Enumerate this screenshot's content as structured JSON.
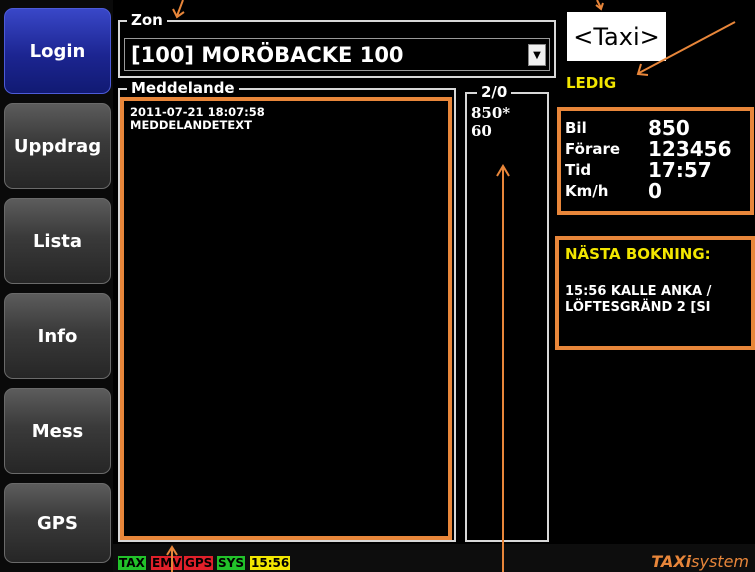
{
  "sidebar": {
    "items": [
      {
        "label": "Login"
      },
      {
        "label": "Uppdrag"
      },
      {
        "label": "Lista"
      },
      {
        "label": "Info"
      },
      {
        "label": "Mess"
      },
      {
        "label": "GPS"
      }
    ]
  },
  "zone": {
    "legend": "Zon",
    "selected": "[100] MORÖBACKE 100"
  },
  "messages": {
    "legend": "Meddelande",
    "timestamp": "2011-07-21 18:07:58",
    "text": "MEDDELANDETEXT"
  },
  "side_panel": {
    "legend": "2/0",
    "items": [
      "850*",
      "60"
    ]
  },
  "taxi_badge": "<Taxi>",
  "status": "LEDIG",
  "vehicle_info": {
    "bil_label": "Bil",
    "bil_value": "850",
    "forare_label": "Förare",
    "forare_value": "123456",
    "tid_label": "Tid",
    "tid_value": "17:57",
    "kmh_label": "Km/h",
    "kmh_value": "0"
  },
  "next_booking": {
    "title": "NÄSTA BOKNING:",
    "line1": "15:56 KALLE ANKA /",
    "line2": "LÖFTESGRÄND 2 [SI"
  },
  "status_bar": {
    "tags": [
      {
        "label": "TAX",
        "color": "#22c22a"
      },
      {
        "label": "EMV",
        "color": "#e0202a"
      },
      {
        "label": "GPS",
        "color": "#e0202a"
      },
      {
        "label": "SYS",
        "color": "#22c22a"
      },
      {
        "label": "15:56",
        "color": "#f2e600"
      }
    ],
    "brand_a": "TAXi",
    "brand_b": "system"
  },
  "colors": {
    "annotation": "#e8863a",
    "active": "#1c2591",
    "highlight": "#f2e600"
  }
}
